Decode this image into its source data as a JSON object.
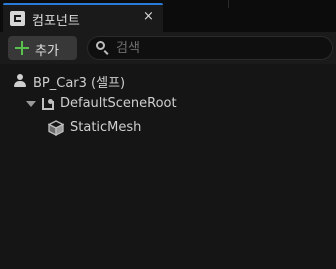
{
  "panel": {
    "tab_title": "컴포넌트",
    "close_symbol": "×",
    "accent_color": "#2b7cd8"
  },
  "toolbar": {
    "add_label": "추가",
    "add_icon": "plus-icon",
    "add_icon_color": "#59c24c"
  },
  "search": {
    "placeholder": "검색",
    "value": ""
  },
  "tree": {
    "items": [
      {
        "label": "BP_Car3 (셀프)",
        "icon": "actor-icon",
        "expanded": null
      },
      {
        "label": "DefaultSceneRoot",
        "icon": "scene-root-icon",
        "expanded": true
      },
      {
        "label": "StaticMesh",
        "icon": "static-mesh-icon",
        "expanded": null
      }
    ]
  }
}
